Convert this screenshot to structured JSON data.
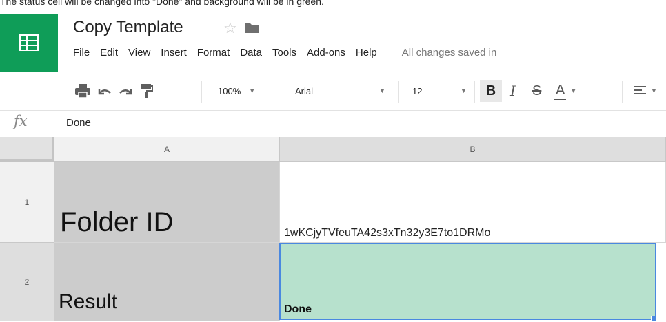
{
  "caption": "The status cell will be changed into \"Done\" and background will be in green.",
  "doc": {
    "title": "Copy Template"
  },
  "menu": [
    "File",
    "Edit",
    "View",
    "Insert",
    "Format",
    "Data",
    "Tools",
    "Add-ons",
    "Help"
  ],
  "saved_status": "All changes saved in",
  "toolbar": {
    "zoom": "100%",
    "font": "Arial",
    "size": "12",
    "bold": "B",
    "italic": "I",
    "strike": "S",
    "text_color": "A"
  },
  "formula_bar": {
    "fx": "fx",
    "value": "Done"
  },
  "columns": [
    "A",
    "B"
  ],
  "rows": [
    {
      "num": "1",
      "a": "Folder ID",
      "b": "1wKCjyTVfeuTA42s3xTn32y3E7to1DRMo"
    },
    {
      "num": "2",
      "a": "Result",
      "b": "Done"
    }
  ],
  "colors": {
    "brand": "#0f9d58",
    "active_cell_bg": "#b7e1cd",
    "selection": "#4a88e0"
  }
}
